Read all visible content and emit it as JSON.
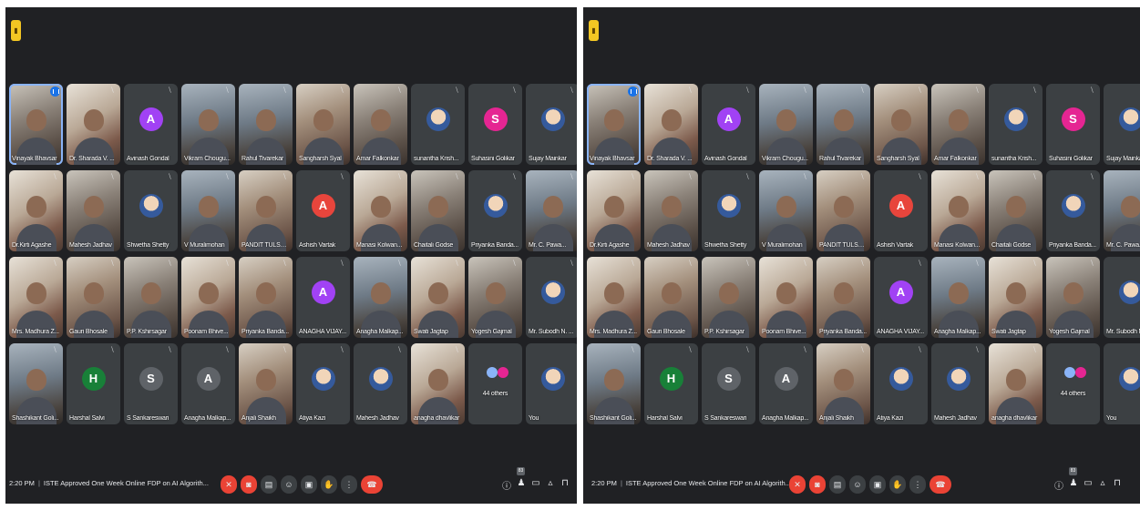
{
  "meeting": {
    "time": "2:20 PM",
    "title": "ISTE Approved One Week Online FDP on AI Algorith...",
    "others_count_label": "44 others",
    "you_label": "You",
    "chat_count": "83"
  },
  "participants": [
    {
      "name": "Vinayak Bhavsar",
      "kind": "video",
      "speaking": true
    },
    {
      "name": "Dr. Sharada V. ...",
      "kind": "video",
      "variant": "v2"
    },
    {
      "name": "Avinash Gondal",
      "kind": "letter",
      "letter": "A",
      "color": "#a142f4"
    },
    {
      "name": "Vikram Chougu...",
      "kind": "video",
      "variant": "v3"
    },
    {
      "name": "Rahul Tivarekar",
      "kind": "video",
      "variant": "v3"
    },
    {
      "name": "Sangharsh Syal",
      "kind": "video",
      "variant": "v4"
    },
    {
      "name": "Amar Falkonkar",
      "kind": "video"
    },
    {
      "name": "sunantha Krish...",
      "kind": "photo"
    },
    {
      "name": "Suhasini Golikar",
      "kind": "letter",
      "letter": "S",
      "color": "#e52592"
    },
    {
      "name": "Sujay Mainkar",
      "kind": "photo"
    },
    {
      "name": "Dr.Kirti Agashe",
      "kind": "video",
      "variant": "v2"
    },
    {
      "name": "Mahesh Jadhav",
      "kind": "video"
    },
    {
      "name": "Shwetha Shetty",
      "kind": "photo"
    },
    {
      "name": "V Muralimohan",
      "kind": "video",
      "variant": "v3"
    },
    {
      "name": "PANDIT TULSHI...",
      "kind": "video",
      "variant": "v4"
    },
    {
      "name": "Ashish Vartak",
      "kind": "letter",
      "letter": "A",
      "color": "#e8453c"
    },
    {
      "name": "Manasi Kolwan...",
      "kind": "video",
      "variant": "v2"
    },
    {
      "name": "Chaitali Godse",
      "kind": "video"
    },
    {
      "name": "Priyanka Banda...",
      "kind": "photo"
    },
    {
      "name": "Mr. C. Pawa...",
      "kind": "video",
      "variant": "v3"
    },
    {
      "name": "Mrs. Madhura Z...",
      "kind": "video",
      "variant": "v2"
    },
    {
      "name": "Gauri Bhosale",
      "kind": "video",
      "variant": "v4"
    },
    {
      "name": "P.P. Kshirsagar",
      "kind": "video"
    },
    {
      "name": "Poonam Bhive...",
      "kind": "video",
      "variant": "v2"
    },
    {
      "name": "Priyanka Banda...",
      "kind": "video",
      "variant": "v4"
    },
    {
      "name": "ANAGHA VIJAY...",
      "kind": "letter",
      "letter": "A",
      "color": "#a142f4"
    },
    {
      "name": "Anagha Malkap...",
      "kind": "video",
      "variant": "v3"
    },
    {
      "name": "Swati Jagtap",
      "kind": "video",
      "variant": "v2"
    },
    {
      "name": "Yogesh Gajmal",
      "kind": "video"
    },
    {
      "name": "Mr. Subodh N. ...",
      "kind": "photo"
    },
    {
      "name": "Shashikant Goli...",
      "kind": "video",
      "variant": "v3"
    },
    {
      "name": "Harshal Salvi",
      "kind": "letter",
      "letter": "H",
      "color": "#188038"
    },
    {
      "name": "S Sankareswari",
      "kind": "letter",
      "letter": "S",
      "color": "#5f6368"
    },
    {
      "name": "Anagha Malkap...",
      "kind": "letter",
      "letter": "A",
      "color": "#5f6368"
    },
    {
      "name": "Anjali Shaikh",
      "kind": "video",
      "variant": "v4"
    },
    {
      "name": "Atiya Kazi",
      "kind": "photo"
    },
    {
      "name": "Mahesh Jadhav",
      "kind": "photo"
    },
    {
      "name": "anagha dhavlikar",
      "kind": "video",
      "variant": "v2"
    },
    {
      "name": "44 others",
      "kind": "others"
    },
    {
      "name": "You",
      "kind": "photo"
    }
  ],
  "icons": {
    "mic_off": "mic-off-icon",
    "cam_off": "camera-off-icon",
    "captions": "captions-icon",
    "emoji": "emoji-icon",
    "present": "present-icon",
    "hand": "raise-hand-icon",
    "more": "more-options-icon",
    "leave": "leave-call-icon",
    "info": "meeting-info-icon",
    "people": "people-icon",
    "chat": "chat-icon",
    "activities": "activities-icon",
    "lock": "host-controls-icon"
  }
}
